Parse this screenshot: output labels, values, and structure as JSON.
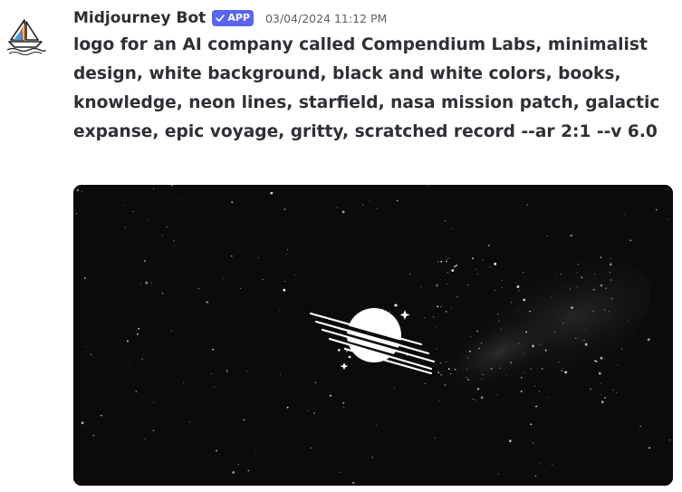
{
  "message": {
    "author": "Midjourney Bot",
    "badge": "APP",
    "timestamp": "03/04/2024 11:12 PM",
    "content": "logo for an AI company called Compendium Labs, minimalist design, white background, black and white colors, books, knowledge, neon lines, starfield, nasa mission patch, galactic expanse, epic voyage, gritty, scratched record --ar 2:1 --v 6.0"
  },
  "icons": {
    "avatar": "sailboat-icon",
    "badge_check": "checkmark-icon"
  }
}
